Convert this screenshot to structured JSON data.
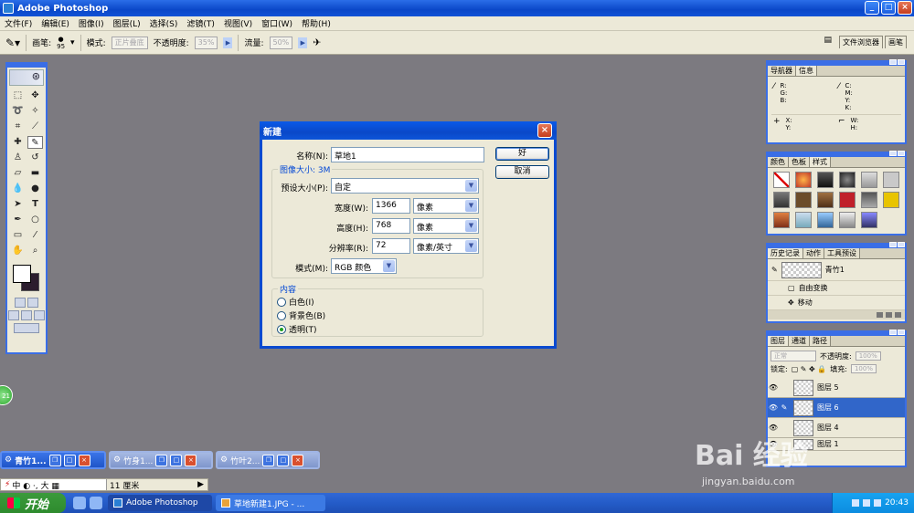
{
  "window": {
    "title": "Adobe Photoshop",
    "controls": [
      "_",
      "□",
      "×"
    ]
  },
  "menu": [
    "文件(F)",
    "编辑(E)",
    "图像(I)",
    "图层(L)",
    "选择(S)",
    "滤镜(T)",
    "视图(V)",
    "窗口(W)",
    "帮助(H)"
  ],
  "options": {
    "brush_label": "画笔:",
    "brush_size": "95",
    "mode_label": "模式:",
    "mode_value": "正片叠底",
    "opacity_label": "不透明度:",
    "opacity_value": "35%",
    "flow_label": "流量:",
    "flow_value": "50%",
    "well_tabs": [
      "文件浏览器",
      "画笔"
    ]
  },
  "palettes": {
    "navigator": {
      "tabs": [
        "导航器",
        "信息"
      ],
      "rgb": "R:\nG:\nB:",
      "cmyk": "C:\nM:\nY:\nK:",
      "xy": "X:\nY:",
      "wh": "W:\nH:"
    },
    "swatches": {
      "tabs": [
        "颜色",
        "色板",
        "样式"
      ]
    },
    "history": {
      "tabs": [
        "历史记录",
        "动作",
        "工具预设"
      ],
      "snapshot": "青竹1",
      "steps": [
        "自由变换",
        "移动"
      ]
    },
    "layers": {
      "tabs": [
        "图层",
        "通道",
        "路径"
      ],
      "blend_mode": "正常",
      "opacity_label": "不透明度:",
      "opacity_value": "100%",
      "lock_label": "锁定:",
      "fill_label": "填充:",
      "fill_value": "100%",
      "items": [
        "图层 5",
        "图层 6",
        "图层 4",
        "图层 1"
      ]
    }
  },
  "minimized_docs": [
    "青竹1...",
    "竹身1...",
    "竹叶2..."
  ],
  "statusbar": {
    "ime": "中 ◐ ·, 大 ▦",
    "size": "11 厘米"
  },
  "taskbar": {
    "start": "开始",
    "items": [
      "Adobe Photoshop",
      "草地新建1.JPG - ..."
    ],
    "clock": "20:43"
  },
  "dialog": {
    "title": "新建",
    "name_label": "名称(N):",
    "name_value": "草地1",
    "image_size": "图像大小: 3M",
    "preset_label": "预设大小(P):",
    "preset_value": "自定",
    "width_label": "宽度(W):",
    "width_value": "1366",
    "width_unit": "像素",
    "height_label": "高度(H):",
    "height_value": "768",
    "height_unit": "像素",
    "res_label": "分辨率(R):",
    "res_value": "72",
    "res_unit": "像素/英寸",
    "mode_label": "模式(M):",
    "mode_value": "RGB 颜色",
    "content_legend": "内容",
    "content_options": [
      "白色(I)",
      "背景色(B)",
      "透明(T)"
    ],
    "content_selected": "透明(T)",
    "ok": "好",
    "cancel": "取消"
  },
  "watermark": {
    "brand": "Bai 经验",
    "url": "jingyan.baidu.com"
  },
  "badge": "21"
}
